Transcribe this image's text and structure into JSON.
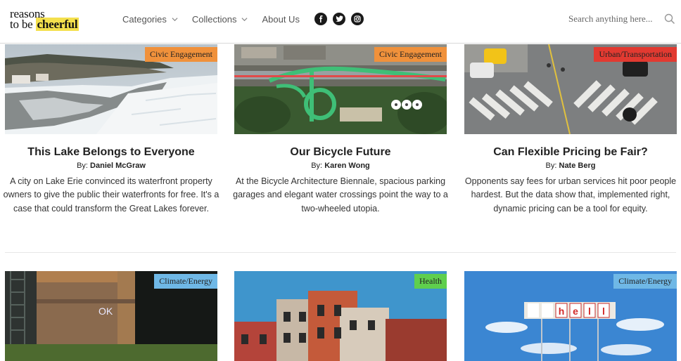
{
  "header": {
    "logo_line1": "reasons",
    "logo_line2_prefix": "to be ",
    "logo_line2_highlight": "cheerful",
    "nav": [
      {
        "label": "Categories",
        "has_dropdown": true
      },
      {
        "label": "Collections",
        "has_dropdown": true
      },
      {
        "label": "About Us",
        "has_dropdown": false
      }
    ],
    "social": [
      "facebook-icon",
      "twitter-icon",
      "instagram-icon"
    ],
    "search_placeholder": "Search anything here..."
  },
  "cards": [
    {
      "category": "Civic Engagement",
      "category_color": "#f0913b",
      "title": "This Lake Belongs to Everyone",
      "by_label": "By:",
      "author": "Daniel McGraw",
      "description": "A city on Lake Erie convinced its waterfront property owners to give the public their waterfronts for free. It's a case that could transform the Great Lakes forever."
    },
    {
      "category": "Civic Engagement",
      "category_color": "#f0913b",
      "title": "Our Bicycle Future",
      "by_label": "By:",
      "author": "Karen Wong",
      "description": "At the Bicycle Architecture Biennale, spacious parking garages and elegant water crossings point the way to a two-wheeled utopia."
    },
    {
      "category": "Urban/Transportation",
      "category_color": "#e23a31",
      "title": "Can Flexible Pricing be Fair?",
      "by_label": "By:",
      "author": "Nate Berg",
      "description": "Opponents say fees for urban services hit poor people hardest. But the data show that, implemented right, dynamic pricing can be a tool for equity."
    },
    {
      "category": "Climate/Energy",
      "category_color": "#6fb8e6"
    },
    {
      "category": "Health",
      "category_color": "#5fcf4d"
    },
    {
      "category": "Climate/Energy",
      "category_color": "#6fb8e6"
    }
  ],
  "images": {
    "card4_graffiti": "OK",
    "card6_sign": [
      "h",
      "e",
      "l",
      "l"
    ]
  }
}
